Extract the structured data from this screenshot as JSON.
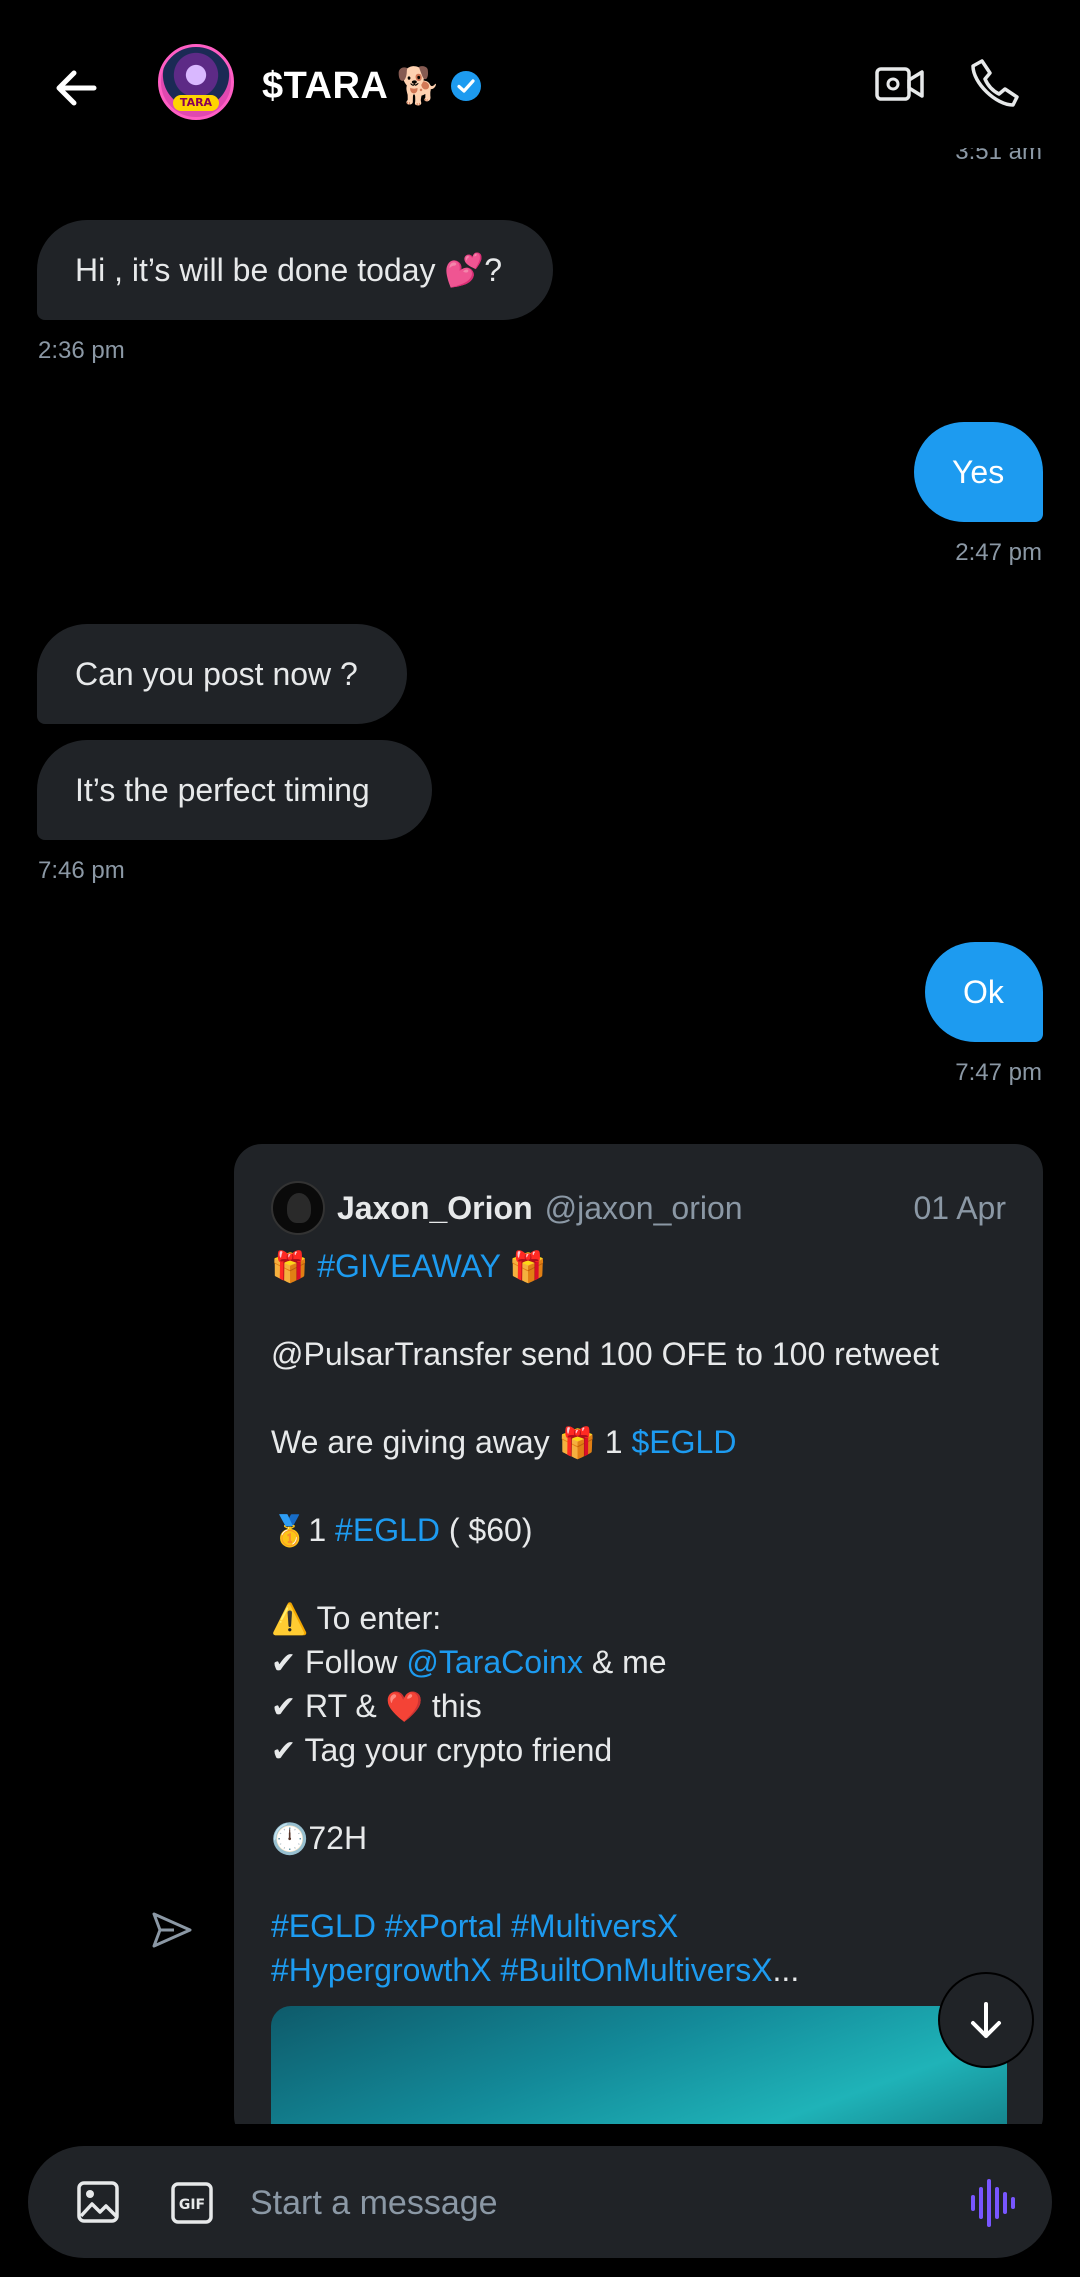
{
  "header": {
    "title": "$TARA",
    "title_emoji": "🐕",
    "avatar_tag": "TARA",
    "back_icon": "arrow-left-icon",
    "verified_icon": "verified-badge-icon",
    "video_icon": "video-camera-icon",
    "call_icon": "phone-icon",
    "accent_color": "#1d9bf0"
  },
  "cut_timestamp": "3:51 am",
  "messages": [
    {
      "direction": "in",
      "text": "Hi , it’s will be done today 💕?"
    },
    {
      "direction": "out",
      "text": "Yes"
    },
    {
      "direction": "in",
      "text": "Can you post now ?"
    },
    {
      "direction": "in",
      "text": "It’s the perfect timing"
    },
    {
      "direction": "out",
      "text": "Ok"
    }
  ],
  "timestamps": {
    "t1": "2:36 pm",
    "t2": "2:47 pm",
    "t3": "7:46 pm",
    "t4": "7:47 pm"
  },
  "tweet": {
    "name": "Jaxon_Orion",
    "handle": "@jaxon_orion",
    "date": "01 Apr",
    "gift_emoji": "🎁",
    "hashtag_giveaway": "#GIVEAWAY",
    "line_pulsar": "@PulsarTransfer send 100 OFE to 100 retweet",
    "giving_prefix": "We are giving away",
    "giving_amount": " 1 ",
    "giving_ticker": "$EGLD",
    "medal_emoji": "🥇",
    "medal_amount": "1 ",
    "medal_tag": "#EGLD",
    "medal_value": " ( $60)",
    "warning_emoji": "⚠️",
    "to_enter": " To enter:",
    "check": "✔",
    "follow_prefix": " Follow ",
    "follow_handle": "@TaraCoinx",
    "follow_suffix": " & me",
    "rt_prefix": " RT & ",
    "heart_emoji": "❤️",
    "rt_suffix": " this",
    "tag_line": " Tag your crypto friend",
    "clock_emoji": "🕛",
    "duration": "72H",
    "hashtags_1": "#EGLD #xPortal #MultiversX",
    "hashtags_2": "#HypergrowthX #BuiltOnMultiversX",
    "ellipsis": "..."
  },
  "composer": {
    "placeholder": "Start a message",
    "image_icon": "image-icon",
    "gif_icon": "gif-icon",
    "voice_icon": "voice-wave-icon",
    "voice_color": "#7856ff"
  },
  "share_icon": "send-icon",
  "scroll_icon": "arrow-down-icon"
}
